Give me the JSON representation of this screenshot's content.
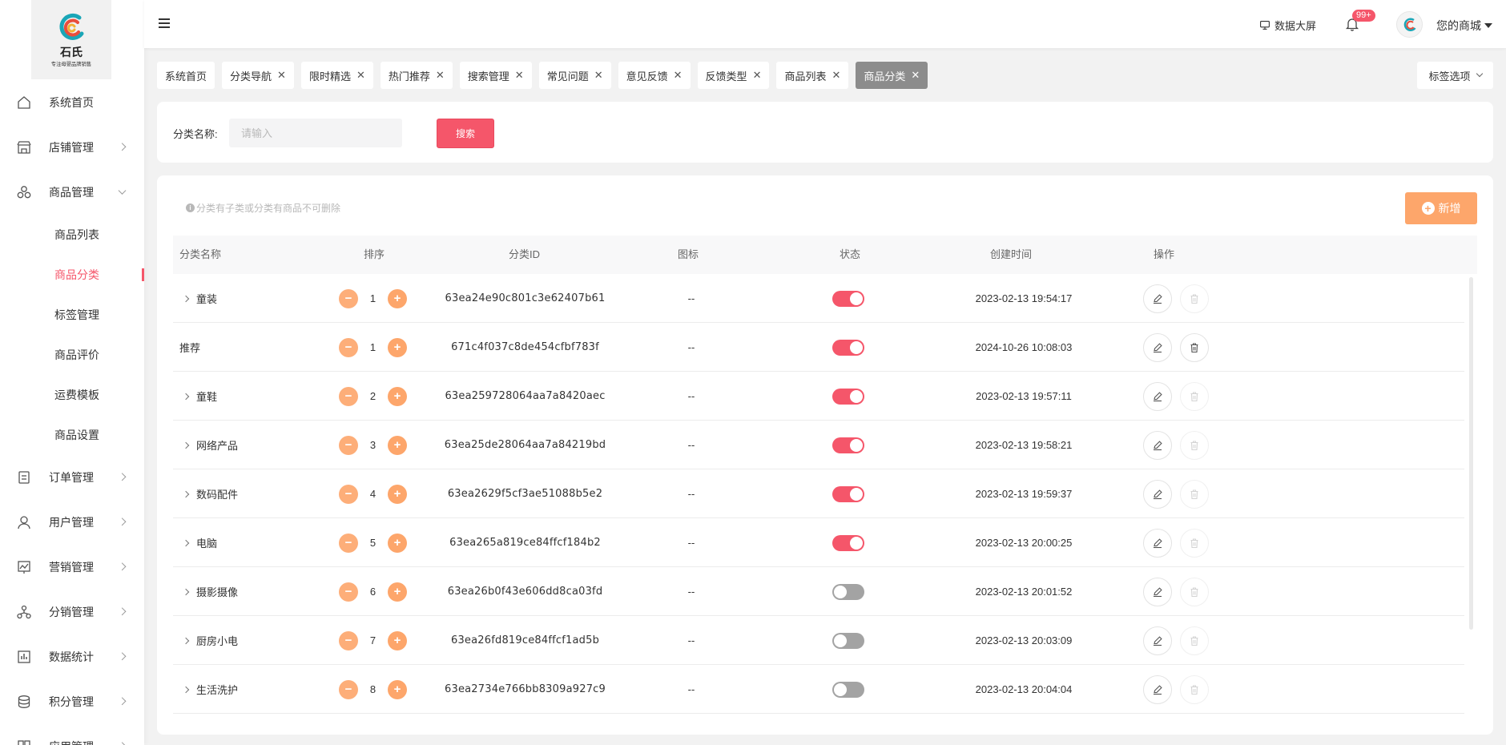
{
  "brand": {
    "name": "石氏",
    "tagline": "专注母婴品牌销售"
  },
  "sidebar": {
    "items": [
      {
        "key": "home",
        "label": "系统首页",
        "icon": "home-icon",
        "arrow": "none"
      },
      {
        "key": "store",
        "label": "店铺管理",
        "icon": "store-icon",
        "arrow": "right"
      },
      {
        "key": "goods",
        "label": "商品管理",
        "icon": "goods-icon",
        "arrow": "down",
        "children": [
          "商品列表",
          "商品分类",
          "标签管理",
          "商品评价",
          "运费模板",
          "商品设置"
        ],
        "active_child": 1
      },
      {
        "key": "orders",
        "label": "订单管理",
        "icon": "order-icon",
        "arrow": "right"
      },
      {
        "key": "users",
        "label": "用户管理",
        "icon": "user-icon",
        "arrow": "right"
      },
      {
        "key": "marketing",
        "label": "营销管理",
        "icon": "marketing-icon",
        "arrow": "right"
      },
      {
        "key": "distribution",
        "label": "分销管理",
        "icon": "distribution-icon",
        "arrow": "right"
      },
      {
        "key": "stats",
        "label": "数据统计",
        "icon": "stats-icon",
        "arrow": "right"
      },
      {
        "key": "points",
        "label": "积分管理",
        "icon": "points-icon",
        "arrow": "right"
      },
      {
        "key": "apps",
        "label": "应用管理",
        "icon": "apps-icon",
        "arrow": "right"
      }
    ]
  },
  "header": {
    "data_screen": "数据大屏",
    "notify_badge": "99+",
    "user_name": "您的商城"
  },
  "tags": {
    "items": [
      {
        "label": "系统首页",
        "closable": false
      },
      {
        "label": "分类导航",
        "closable": true
      },
      {
        "label": "限时精选",
        "closable": true
      },
      {
        "label": "热门推荐",
        "closable": true
      },
      {
        "label": "搜索管理",
        "closable": true
      },
      {
        "label": "常见问题",
        "closable": true
      },
      {
        "label": "意见反馈",
        "closable": true
      },
      {
        "label": "反馈类型",
        "closable": true
      },
      {
        "label": "商品列表",
        "closable": true
      },
      {
        "label": "商品分类",
        "closable": true,
        "active": true
      }
    ],
    "options_label": "标签选项"
  },
  "search": {
    "label": "分类名称:",
    "placeholder": "请输入",
    "button": "搜索"
  },
  "table": {
    "notice": "分类有子类或分类有商品不可删除",
    "add_label": "新增",
    "columns": [
      "分类名称",
      "排序",
      "分类ID",
      "图标",
      "状态",
      "创建时间",
      "操作"
    ],
    "rows": [
      {
        "name": "童装",
        "has_children": true,
        "sort": "1",
        "id": "63ea24e90c801c3e62407b61",
        "icon": "--",
        "enabled": true,
        "created": "2023-02-13 19:54:17",
        "deletable": false
      },
      {
        "name": "推荐",
        "has_children": false,
        "sort": "1",
        "id": "671c4f037c8de454cfbf783f",
        "icon": "--",
        "enabled": true,
        "created": "2024-10-26 10:08:03",
        "deletable": true
      },
      {
        "name": "童鞋",
        "has_children": true,
        "sort": "2",
        "id": "63ea259728064aa7a8420aec",
        "icon": "--",
        "enabled": true,
        "created": "2023-02-13 19:57:11",
        "deletable": false
      },
      {
        "name": "网络产品",
        "has_children": true,
        "sort": "3",
        "id": "63ea25de28064aa7a84219bd",
        "icon": "--",
        "enabled": true,
        "created": "2023-02-13 19:58:21",
        "deletable": false
      },
      {
        "name": "数码配件",
        "has_children": true,
        "sort": "4",
        "id": "63ea2629f5cf3ae51088b5e2",
        "icon": "--",
        "enabled": true,
        "created": "2023-02-13 19:59:37",
        "deletable": false
      },
      {
        "name": "电脑",
        "has_children": true,
        "sort": "5",
        "id": "63ea265a819ce84ffcf184b2",
        "icon": "--",
        "enabled": true,
        "created": "2023-02-13 20:00:25",
        "deletable": false
      },
      {
        "name": "摄影摄像",
        "has_children": true,
        "sort": "6",
        "id": "63ea26b0f43e606dd8ca03fd",
        "icon": "--",
        "enabled": false,
        "created": "2023-02-13 20:01:52",
        "deletable": false
      },
      {
        "name": "厨房小电",
        "has_children": true,
        "sort": "7",
        "id": "63ea26fd819ce84ffcf1ad5b",
        "icon": "--",
        "enabled": false,
        "created": "2023-02-13 20:03:09",
        "deletable": false
      },
      {
        "name": "生活洗护",
        "has_children": true,
        "sort": "8",
        "id": "63ea2734e766bb8309a927c9",
        "icon": "--",
        "enabled": false,
        "created": "2023-02-13 20:04:04",
        "deletable": false
      }
    ]
  },
  "colors": {
    "accent": "#f5566a",
    "orange": "#fda66b",
    "toggle_off": "#a3a3a3"
  }
}
